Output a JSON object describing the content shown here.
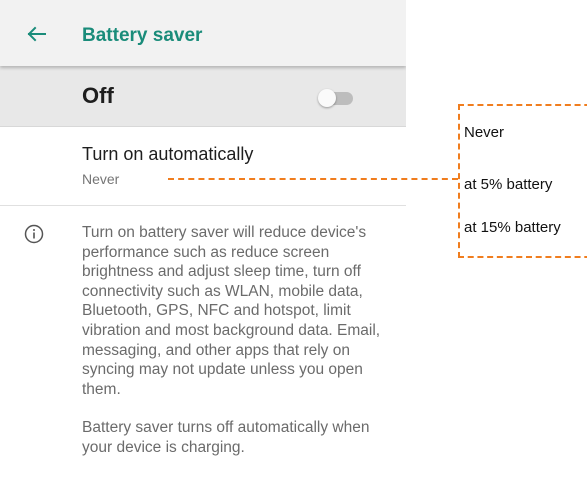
{
  "appbar": {
    "title": "Battery saver",
    "back_icon": "arrow-left-icon"
  },
  "master_switch": {
    "label": "Off",
    "state": "off"
  },
  "auto_setting": {
    "title": "Turn on automatically",
    "value": "Never"
  },
  "description": {
    "icon": "info-icon",
    "paragraphs": [
      "Turn on battery saver will reduce device's performance such as reduce screen brightness and adjust sleep time, turn off connectivity such as WLAN, mobile data, Bluetooth, GPS, NFC and hotspot, limit vibration and most background data. Email, messaging, and other apps that rely on syncing may not update unless you open them.",
      "Battery saver turns off automatically when your device is charging."
    ]
  },
  "auto_options": [
    "Never",
    "at 5% battery",
    "at 15% battery"
  ],
  "colors": {
    "accent": "#1a8c7a",
    "annotation": "#f07d1e"
  }
}
